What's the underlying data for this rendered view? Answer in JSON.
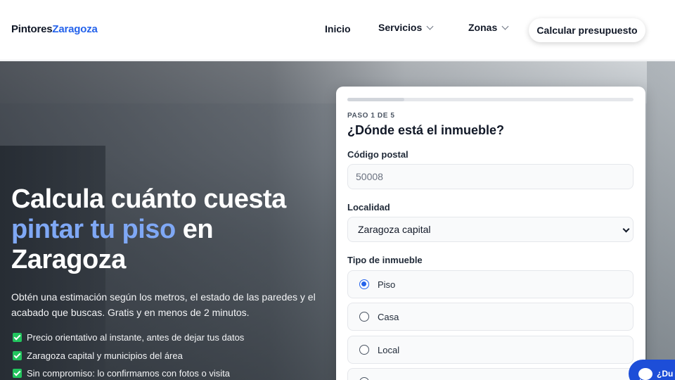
{
  "header": {
    "logo_part1": "Pintores",
    "logo_part2": "Zaragoza",
    "nav": {
      "inicio": "Inicio",
      "servicios": "Servicios",
      "zonas": "Zonas"
    },
    "cta_label": "Calcular presupuesto"
  },
  "hero": {
    "title_line1": "Calcula cuánto cuesta",
    "title_highlight": "pintar tu piso",
    "title_after_highlight": " en",
    "title_line3": "Zaragoza",
    "subtitle": "Obtén una estimación según los metros, el estado de las paredes y el acabado que buscas. Gratis y en menos de 2 minutos.",
    "checklist": [
      "Precio orientativo al instante, antes de dejar tus datos",
      "Zaragoza capital y municipios del área",
      "Sin compromiso: lo confirmamos con fotos o visita"
    ]
  },
  "form": {
    "progress_fraction": 0.2,
    "step_label": "PASO 1 DE 5",
    "title": "¿Dónde está el inmueble?",
    "postal_code": {
      "label": "Código postal",
      "placeholder": "50008"
    },
    "locality": {
      "label": "Localidad",
      "selected": "Zaragoza capital"
    },
    "property_type": {
      "label": "Tipo de inmueble",
      "options": [
        "Piso",
        "Casa",
        "Local"
      ],
      "selected": "Piso"
    }
  },
  "chat": {
    "label": "¿Du"
  },
  "colors": {
    "accent": "#2563eb",
    "highlight": "#7fa8f5",
    "check": "#22c55e"
  }
}
